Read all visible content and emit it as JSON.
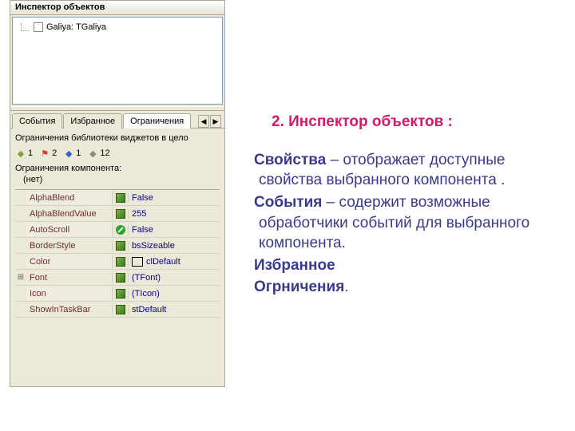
{
  "inspector": {
    "title": "Инспектор объектов",
    "tree": {
      "node_label": "Galiya: TGaliya"
    },
    "tabs": [
      "События",
      "Избранное",
      "Ограничения"
    ],
    "active_tab": 2,
    "arrows": {
      "left": "◀",
      "right": "▶"
    },
    "lib_limit_label": "Ограничения библиотеки виджетов в цело",
    "limit_counts": [
      "1",
      "2",
      "1",
      "12"
    ],
    "flag_glyph": "⚑",
    "cube_glyph": "◆",
    "comp_limit_label": "Ограничения компонента:",
    "comp_limit_value": "(нет)",
    "props": [
      {
        "name": "AlphaBlend",
        "icon": "cube",
        "value": "False",
        "expand": ""
      },
      {
        "name": "AlphaBlendValue",
        "icon": "cube",
        "value": "255",
        "expand": ""
      },
      {
        "name": "AutoScroll",
        "icon": "forbid",
        "value": "False",
        "expand": ""
      },
      {
        "name": "BorderStyle",
        "icon": "cube",
        "value": "bsSizeable",
        "expand": ""
      },
      {
        "name": "Color",
        "icon": "cube",
        "value": "clDefault",
        "expand": "",
        "swatch": true
      },
      {
        "name": "Font",
        "icon": "cube",
        "value": "(TFont)",
        "expand": "⊞"
      },
      {
        "name": "Icon",
        "icon": "cube",
        "value": "(TIcon)",
        "expand": ""
      },
      {
        "name": "ShowInTaskBar",
        "icon": "cube",
        "value": "stDefault",
        "expand": ""
      }
    ]
  },
  "notes": {
    "heading": "2. Инспектор объектов  :",
    "items": [
      {
        "term": "Свойства",
        "rest": " – отображает доступные свойства выбранного компонента ."
      },
      {
        "term": " События",
        "rest": " – содержит возможные обработчики событий для выбранного компонента."
      },
      {
        "term": " Избранное",
        "rest": ""
      },
      {
        "term": "Огрничения",
        "rest": "."
      }
    ]
  }
}
